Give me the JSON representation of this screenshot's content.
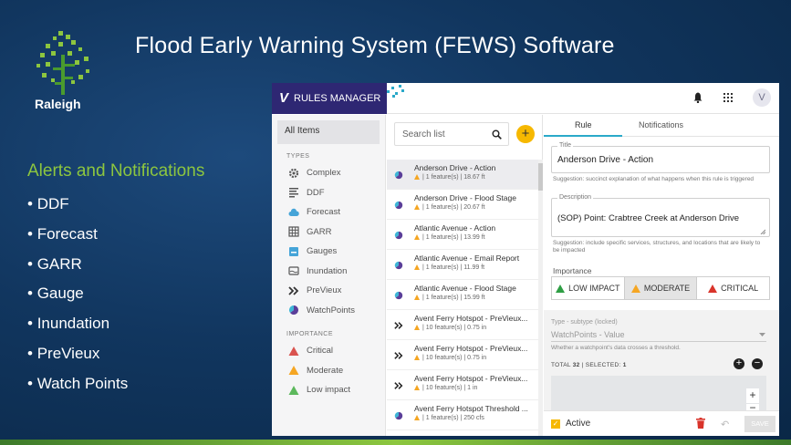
{
  "slide": {
    "title": "Flood Early Warning System (FEWS) Software",
    "logo_text": "Raleigh",
    "section_heading": "Alerts and Notifications",
    "bullets": [
      "DDF",
      "Forecast",
      "GARR",
      "Gauge",
      "Inundation",
      "PreVieux",
      "Watch Points"
    ],
    "colors": {
      "background": "#11365f",
      "accent_green": "#8dc63f"
    }
  },
  "app": {
    "title": "RULES MANAGER",
    "logo_mark": "V",
    "avatar": "V",
    "brand_color": "#2e2773",
    "sidebar": {
      "all_items": "All Items",
      "types_heading": "TYPES",
      "types": [
        {
          "label": "Complex",
          "icon": "gear-icon"
        },
        {
          "label": "DDF",
          "icon": "list-icon"
        },
        {
          "label": "Forecast",
          "icon": "cloud-icon"
        },
        {
          "label": "GARR",
          "icon": "grid-icon"
        },
        {
          "label": "Gauges",
          "icon": "gauge-icon"
        },
        {
          "label": "Inundation",
          "icon": "inundation-icon"
        },
        {
          "label": "PreVieux",
          "icon": "double-chevron-icon"
        },
        {
          "label": "WatchPoints",
          "icon": "watchpoint-icon"
        }
      ],
      "importance_heading": "IMPORTANCE",
      "importance": [
        {
          "label": "Critical",
          "color": "#d9534f"
        },
        {
          "label": "Moderate",
          "color": "#f5a623"
        },
        {
          "label": "Low impact",
          "color": "#5cb85c"
        }
      ]
    },
    "list": {
      "search_placeholder": "Search list",
      "add_label": "+",
      "items": [
        {
          "title": "Anderson Drive - Action",
          "sub": "| 1 feature(s) | 18.67 ft",
          "icon": "watchpoint-icon"
        },
        {
          "title": "Anderson Drive - Flood Stage",
          "sub": "| 1 feature(s) | 20.67 ft",
          "icon": "watchpoint-icon"
        },
        {
          "title": "Atlantic Avenue - Action",
          "sub": "| 1 feature(s) | 13.99 ft",
          "icon": "watchpoint-icon"
        },
        {
          "title": "Atlantic Avenue - Email Report",
          "sub": "| 1 feature(s) | 11.99 ft",
          "icon": "watchpoint-icon"
        },
        {
          "title": "Atlantic Avenue - Flood Stage",
          "sub": "| 1 feature(s) | 15.99 ft",
          "icon": "watchpoint-icon"
        },
        {
          "title": "Avent Ferry Hotspot - PreVieux...",
          "sub": "| 10 feature(s) | 0.75 in",
          "icon": "double-chevron-icon"
        },
        {
          "title": "Avent Ferry Hotspot - PreVieux...",
          "sub": "| 10 feature(s) | 0.75 in",
          "icon": "double-chevron-icon"
        },
        {
          "title": "Avent Ferry Hotspot - PreVieux...",
          "sub": "| 10 feature(s) | 1 in",
          "icon": "double-chevron-icon"
        },
        {
          "title": "Avent Ferry Hotspot Threshold ...",
          "sub": "| 1 feature(s) | 250 cfs",
          "icon": "watchpoint-icon"
        }
      ]
    },
    "detail": {
      "tabs": [
        "Rule",
        "Notifications"
      ],
      "title_label": "Title",
      "title_value": "Anderson Drive - Action",
      "title_hint": "Suggestion: succinct explanation of what happens when this rule is triggered",
      "desc_label": "Description",
      "desc_value": "(SOP) Point: Crabtree Creek at Anderson Drive",
      "desc_hint": "Suggestion: include specific services, structures, and locations that are likely to be impacted",
      "importance_label": "Importance",
      "importance_options": [
        {
          "label": "LOW IMPACT",
          "color": "#2e9e44"
        },
        {
          "label": "MODERATE",
          "color": "#f5a623"
        },
        {
          "label": "CRITICAL",
          "color": "#d9342b"
        }
      ],
      "subtype_label": "Type - subtype (locked)",
      "subtype_value": "WatchPoints - Value",
      "subtype_hint": "Whether a watchpoint's data crosses a threshold.",
      "total_text": "TOTAL",
      "total_count": "32",
      "selected_text": "SELECTED",
      "selected_count": "1",
      "active_label": "Active",
      "save_label": "SAVE"
    }
  }
}
